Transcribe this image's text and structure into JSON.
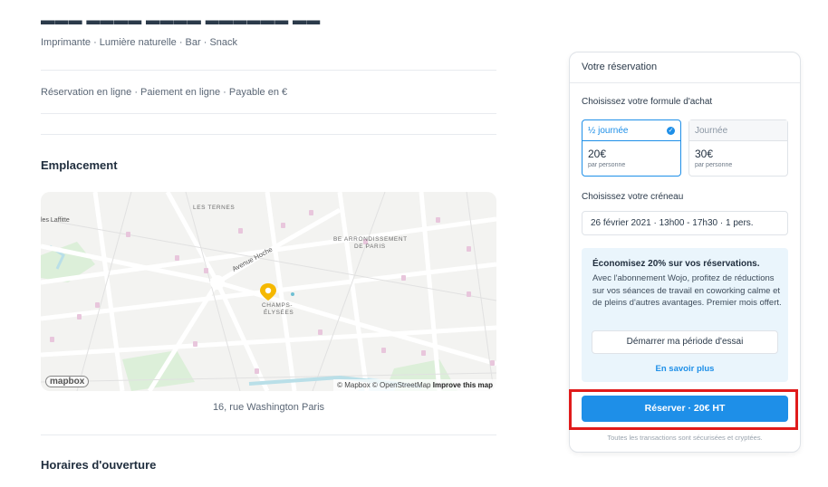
{
  "listing": {
    "amenities": "Imprimante · Lumière naturelle · Bar · Snack",
    "booking_info": "Réservation en ligne · Paiement en ligne · Payable en €",
    "location_title": "Emplacement",
    "address": "16, rue Washington Paris",
    "hours_title": "Horaires d'ouverture"
  },
  "map": {
    "labels": {
      "les_ternes": "LES TERNES",
      "laffitte": "les Laffitte",
      "avenue_hoche": "Avenue Hoche",
      "be_arr_1": "BE ARRONDISSEMENT",
      "be_arr_2": "DE PARIS",
      "champs_1": "CHAMPS-",
      "champs_2": "ÉLYSÉES"
    },
    "logo": "mapbox",
    "attribution": "© Mapbox © OpenStreetMap",
    "improve": "Improve this map",
    "marker_color": "#f5b800"
  },
  "booking": {
    "title": "Votre réservation",
    "formula_label": "Choisissez votre formule d'achat",
    "options": [
      {
        "name": "½ journée",
        "price": "20€",
        "unit": "par personne",
        "selected": true
      },
      {
        "name": "Journée",
        "price": "30€",
        "unit": "par personne",
        "selected": false
      }
    ],
    "check_icon": "check-circle-icon",
    "slot_label": "Choisissez votre créneau",
    "slot_value": "26 février 2021 · 13h00 - 17h30 · 1 pers.",
    "promo": {
      "title": "Économisez 20% sur vos réservations.",
      "text": "Avec l'abonnement Wojo, profitez de réductions sur vos séances de travail en coworking calme et de pleins d'autres avantages. Premier mois offert.",
      "trial_button": "Démarrer ma période d'essai",
      "learn_more": "En savoir plus"
    },
    "reserve_button": "Réserver · 20€ HT",
    "secure_note": "Toutes les transactions sont sécurisées et cryptées."
  },
  "colors": {
    "accent": "#1e8fe8",
    "highlight_box": "#e01b1b"
  }
}
